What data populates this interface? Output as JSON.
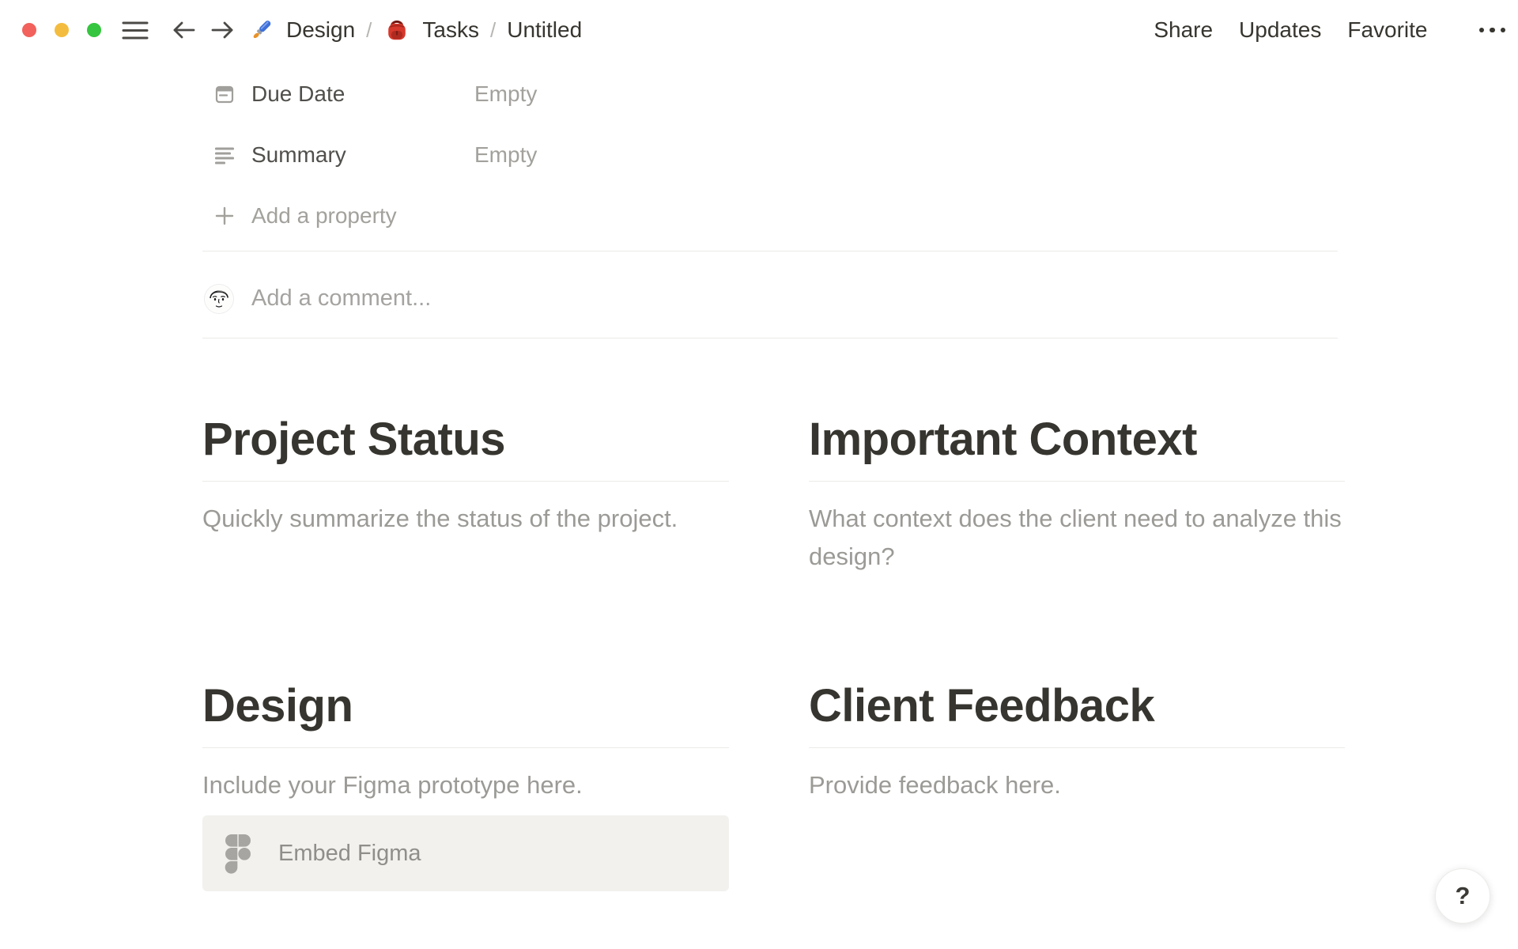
{
  "topbar": {
    "breadcrumb": {
      "item1": "Design",
      "item2": "Tasks",
      "item3": "Untitled",
      "separator": "/"
    },
    "share": "Share",
    "updates": "Updates",
    "favorite": "Favorite"
  },
  "properties": {
    "rows": [
      {
        "icon": "calendar-icon",
        "label": "Due Date",
        "value": "Empty"
      },
      {
        "icon": "align-left-icon",
        "label": "Summary",
        "value": "Empty"
      }
    ],
    "add_property": "Add a property"
  },
  "comment": {
    "placeholder": "Add a comment..."
  },
  "sections": {
    "project_status": {
      "title": "Project Status",
      "body": "Quickly summarize the status of the project."
    },
    "important_context": {
      "title": "Important Context",
      "body": "What context does the client need to analyze this design?"
    },
    "design": {
      "title": "Design",
      "body": "Include your Figma prototype here.",
      "embed_label": "Embed Figma"
    },
    "client_feedback": {
      "title": "Client Feedback",
      "body": "Provide feedback here."
    }
  },
  "help": {
    "label": "?"
  },
  "icons": {
    "hamburger-icon": "three horizontal lines",
    "back-arrow-icon": "left arrow",
    "forward-arrow-icon": "right arrow",
    "paintbrush-emoji-icon": "blue paintbrush emoji",
    "backpack-emoji-icon": "red backpack emoji",
    "more-options-icon": "three dots",
    "calendar-icon": "calendar outline",
    "align-left-icon": "left-aligned text lines",
    "plus-icon": "plus sign",
    "figma-icon": "gray figma logo",
    "question-icon": "question mark"
  },
  "colors": {
    "traffic_red": "#F2615B",
    "traffic_yellow": "#F4BC3E",
    "traffic_green": "#35C53F",
    "text_dark": "#37352f",
    "text_gray": "#9b9a96",
    "text_empty": "#a3a19c",
    "divider": "#ebebe9",
    "embed_bg": "#f2f1ee",
    "figma_gray": "#a7a5a1"
  }
}
